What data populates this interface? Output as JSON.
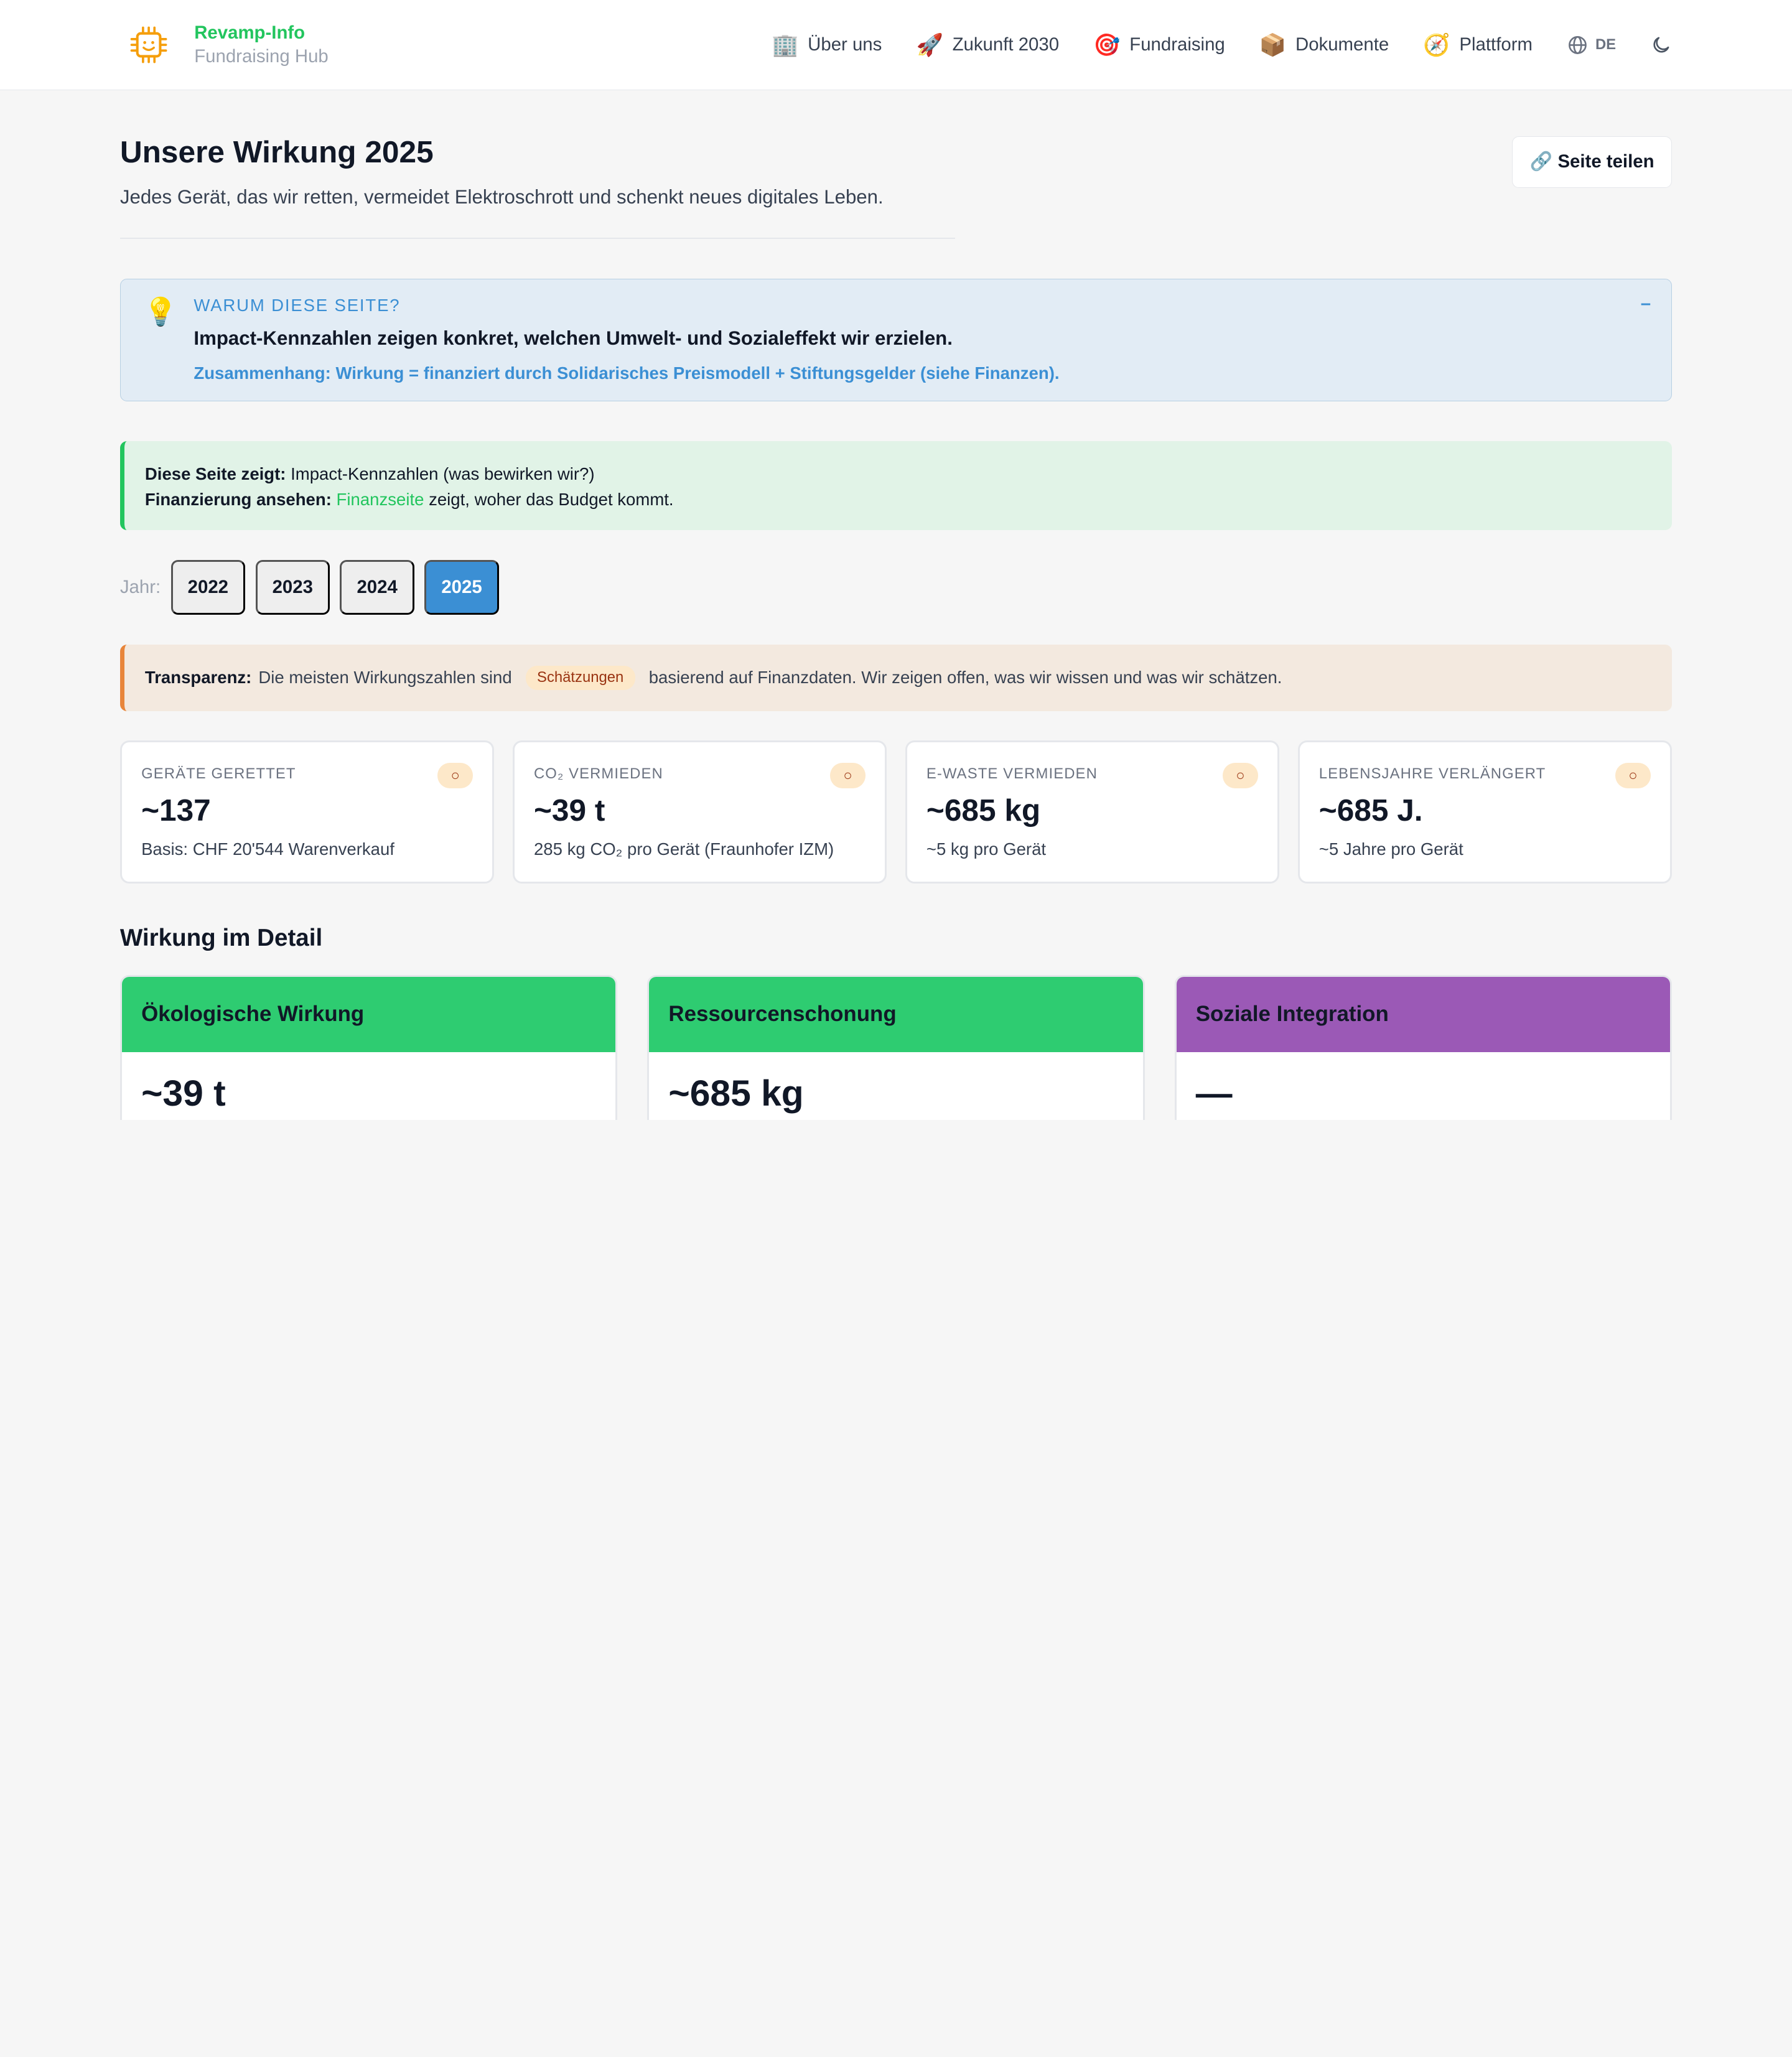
{
  "brand": {
    "name": "Revamp-Info",
    "subtitle": "Fundraising Hub"
  },
  "nav": {
    "items": [
      {
        "icon": "🏢",
        "label": "Über uns"
      },
      {
        "icon": "🚀",
        "label": "Zukunft 2030"
      },
      {
        "icon": "🎯",
        "label": "Fundraising"
      },
      {
        "icon": "📦",
        "label": "Dokumente"
      },
      {
        "icon": "🧭",
        "label": "Plattform"
      }
    ],
    "language": "DE"
  },
  "page": {
    "title": "Unsere Wirkung 2025",
    "subtitle": "Jedes Gerät, das wir retten, vermeidet Elektroschrott und schenkt neues digitales Leben.",
    "share_label": "🔗 Seite teilen"
  },
  "why": {
    "label": "Warum diese Seite?",
    "title": "Impact-Kennzahlen zeigen konkret, welchen Umwelt- und Sozialeffekt wir erzielen.",
    "relation": "Zusammenhang: Wirkung = finanziert durch Solidarisches Preismodell + Stiftungsgelder (siehe Finanzen).",
    "toggle": "–"
  },
  "info": {
    "line1_bold": "Diese Seite zeigt:",
    "line1_text": "Impact-Kennzahlen (was bewirken wir?)",
    "line2_bold": "Finanzierung ansehen:",
    "line2_link": "Finanzseite",
    "line2_text": "zeigt, woher das Budget kommt."
  },
  "years": {
    "label": "Jahr:",
    "options": [
      "2022",
      "2023",
      "2024",
      "2025"
    ],
    "selected": "2025"
  },
  "transparency": {
    "bold": "Transparenz:",
    "text_before": "Die meisten Wirkungszahlen sind",
    "badge": "Schätzungen",
    "text_after": "basierend auf Finanzdaten. Wir zeigen offen, was wir wissen und was wir schätzen."
  },
  "kpis": [
    {
      "label": "Geräte gerettet",
      "value": "~137",
      "note": "Basis: CHF 20'544 Warenverkauf",
      "badge": "○"
    },
    {
      "label": "CO₂ vermieden",
      "value": "~39 t",
      "note": "285 kg CO₂ pro Gerät (Fraunhofer IZM)",
      "badge": "○"
    },
    {
      "label": "E-Waste vermieden",
      "value": "~685 kg",
      "note": "~5 kg pro Gerät",
      "badge": "○"
    },
    {
      "label": "Lebensjahre verlängert",
      "value": "~685 J.",
      "note": "~5 Jahre pro Gerät",
      "badge": "○"
    }
  ],
  "details": {
    "title": "Wirkung im Detail",
    "cards": [
      {
        "title": "Ökologische Wirkung",
        "value": "~39 t",
        "color": "#2ecc71"
      },
      {
        "title": "Ressourcenschonung",
        "value": "~685 kg",
        "color": "#2ecc71"
      },
      {
        "title": "Soziale Integration",
        "value": "—",
        "color": "#9b59b6"
      }
    ]
  },
  "colors": {
    "accent_blue": "#3b8fd4",
    "accent_green": "#22c55e",
    "accent_orange": "#e8853a"
  }
}
